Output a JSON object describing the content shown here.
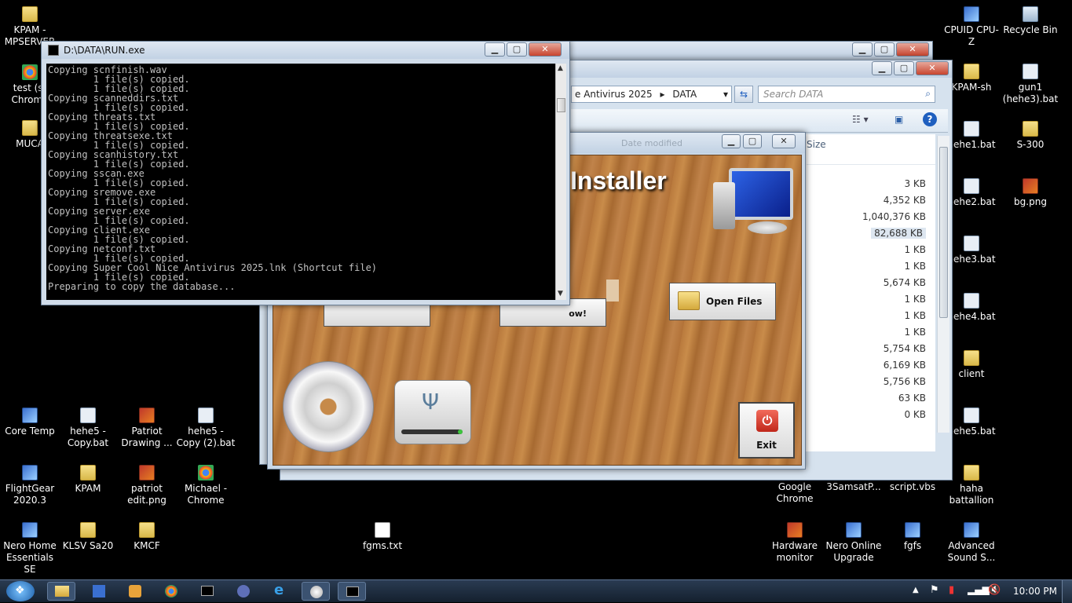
{
  "desktop": {
    "icons_left": [
      {
        "label": "KPAM - MPSERVER",
        "icon": "folder-icon"
      },
      {
        "label": "test (s) Chrome",
        "icon": "chrome-icon"
      },
      {
        "label": "MUCA",
        "icon": "folder-icon"
      },
      {
        "label": "Core Temp",
        "icon": "app-icon"
      },
      {
        "label": "hehe5 - Copy.bat",
        "icon": "bat-file-icon"
      },
      {
        "label": "Patriot Drawing ...",
        "icon": "png-file-icon"
      },
      {
        "label": "hehe5 - Copy (2).bat",
        "icon": "bat-file-icon"
      },
      {
        "label": "FlightGear 2020.3",
        "icon": "app-icon"
      },
      {
        "label": "KPAM",
        "icon": "folder-icon"
      },
      {
        "label": "patriot edit.png",
        "icon": "png-file-icon"
      },
      {
        "label": "Michael - Chrome",
        "icon": "chrome-icon"
      },
      {
        "label": "Nero Home Essentials SE",
        "icon": "app-icon"
      },
      {
        "label": "KLSV Sa20",
        "icon": "folder-icon"
      },
      {
        "label": "KMCF",
        "icon": "folder-icon"
      },
      {
        "label": "fgms.txt",
        "icon": "txt-file-icon"
      }
    ],
    "icons_right": [
      {
        "label": "CPUID CPU-Z",
        "icon": "app-icon"
      },
      {
        "label": "Recycle Bin",
        "icon": "recycle-bin-icon"
      },
      {
        "label": "KPAM-sh",
        "icon": "folder-icon"
      },
      {
        "label": "gun1 (hehe3).bat",
        "icon": "bat-file-icon"
      },
      {
        "label": "hehe1.bat",
        "icon": "bat-file-icon"
      },
      {
        "label": "S-300",
        "icon": "folder-icon"
      },
      {
        "label": "hehe2.bat",
        "icon": "bat-file-icon"
      },
      {
        "label": "bg.png",
        "icon": "png-file-icon"
      },
      {
        "label": "hehe3.bat",
        "icon": "bat-file-icon"
      },
      {
        "label": "hehe4.bat",
        "icon": "bat-file-icon"
      },
      {
        "label": "client",
        "icon": "folder-icon"
      },
      {
        "label": "hehe5.bat",
        "icon": "bat-file-icon"
      },
      {
        "label": "haha battallion",
        "icon": "folder-icon"
      },
      {
        "label": "Google Chrome",
        "icon": "chrome-icon"
      },
      {
        "label": "3SamsatP...",
        "icon": "app-icon"
      },
      {
        "label": "script.vbs",
        "icon": "txt-file-icon"
      },
      {
        "label": "Hardware monitor",
        "icon": "app-icon"
      },
      {
        "label": "Nero Online Upgrade",
        "icon": "app-icon"
      },
      {
        "label": "fgfs",
        "icon": "app-icon"
      },
      {
        "label": "Advanced Sound S...",
        "icon": "app-icon"
      }
    ]
  },
  "console": {
    "title": "D:\\DATA\\RUN.exe",
    "lines": [
      "Copying scnfinish.wav",
      "        1 file(s) copied.",
      "        1 file(s) copied.",
      "Copying scanneddirs.txt",
      "        1 file(s) copied.",
      "Copying threats.txt",
      "        1 file(s) copied.",
      "Copying threatsexe.txt",
      "        1 file(s) copied.",
      "Copying scanhistory.txt",
      "        1 file(s) copied.",
      "Copying sscan.exe",
      "        1 file(s) copied.",
      "Copying sremove.exe",
      "        1 file(s) copied.",
      "Copying server.exe",
      "        1 file(s) copied.",
      "Copying client.exe",
      "        1 file(s) copied.",
      "Copying netconf.txt",
      "        1 file(s) copied.",
      "Copying Super Cool Nice Antivirus 2025.lnk (Shortcut file)",
      "        1 file(s) copied.",
      "Preparing to copy the database..."
    ]
  },
  "explorer": {
    "breadcrumb_part": "e Antivirus 2025",
    "breadcrumb_current": "DATA",
    "search_placeholder": "Search DATA",
    "column_size": "Size",
    "column_modified": "Date modified",
    "sizes": [
      "3 KB",
      "4,352 KB",
      "1,040,376 KB",
      "82,688 KB",
      "1 KB",
      "1 KB",
      "5,674 KB",
      "1 KB",
      "1 KB",
      "1 KB",
      "5,754 KB",
      "6,169 KB",
      "5,756 KB",
      "63 KB",
      "0 KB"
    ]
  },
  "installer": {
    "title_text": "Installer",
    "open_files_label": "Open Files",
    "exit_label": "Exit",
    "partial_button_label": "ow!"
  },
  "taskbar": {
    "clock": "10:00 PM"
  },
  "colors": {
    "console_bg": "#000000",
    "console_text": "#c0c0c0",
    "wood": "#b87a3c",
    "taskbar": "#1b2a3c"
  }
}
